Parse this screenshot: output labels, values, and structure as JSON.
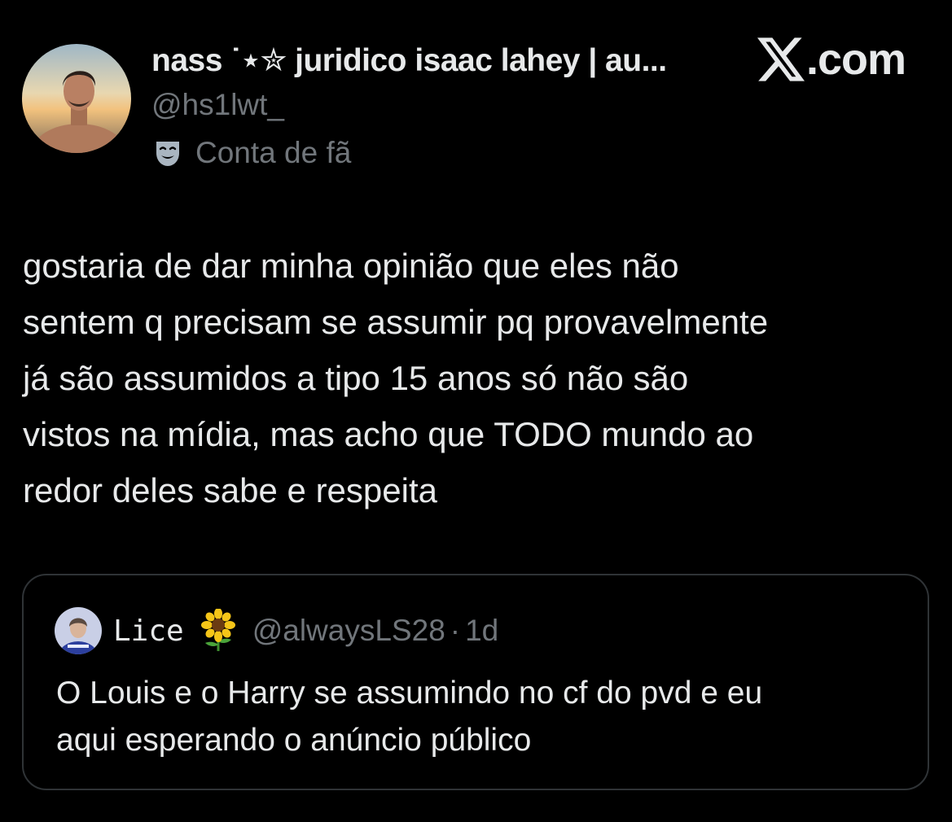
{
  "author": {
    "display_name": "nass ˙⋆✮ juridico isaac lahey | au...",
    "handle": "@hs1lwt_",
    "fan_label": "Conta de fã",
    "avatar_icon": "profile-photo-avatar"
  },
  "brand": {
    "icon": "x-logo-icon",
    "suffix": ".com"
  },
  "tweet": {
    "text": "gostaria de dar minha opinião que eles não\nsentem q precisam se assumir pq provavelmente\njá são assumidos a tipo 15 anos só não são\nvistos na mídia, mas acho que TODO mundo ao\nredor deles sabe e respeita"
  },
  "quoted_tweet": {
    "name": "Lice",
    "emoji_icon": "sunflower-icon",
    "handle": "@alwaysLS28",
    "separator": "·",
    "time": "1d",
    "text": "O Louis e o Harry se assumindo no cf do pvd e eu\naqui esperando o anúncio público"
  },
  "colors": {
    "background": "#000000",
    "primary_text": "#e7e9ea",
    "secondary_text": "#71767b",
    "border": "#2f3336"
  }
}
